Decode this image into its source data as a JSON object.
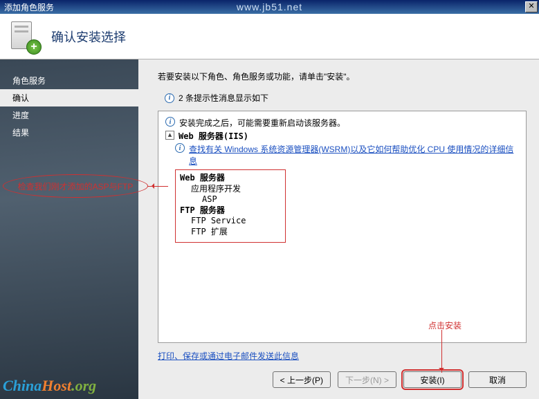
{
  "window": {
    "title": "添加角色服务",
    "watermark": "www.jb51.net",
    "close": "✕"
  },
  "header": {
    "title": "确认安装选择"
  },
  "sidebar": {
    "items": [
      {
        "label": "角色服务",
        "active": false
      },
      {
        "label": "确认",
        "active": true
      },
      {
        "label": "进度",
        "active": false
      },
      {
        "label": "结果",
        "active": false
      }
    ]
  },
  "main": {
    "instruction": "若要安装以下角色、角色服务或功能，请单击\"安装\"。",
    "sub": "2 条提示性消息显示如下",
    "notice": "安装完成之后，可能需要重新启动该服务器。",
    "section": "Web 服务器(IIS)",
    "wsrm_link": "查找有关 Windows 系统资源管理器(WSRM)以及它如何帮助优化 CPU 使用情况的详细信息",
    "highlight": {
      "web_server": "Web 服务器",
      "app_dev": "应用程序开发",
      "asp": "ASP",
      "ftp_server": "FTP 服务器",
      "ftp_service": "FTP Service",
      "ftp_ext": "FTP 扩展"
    },
    "email_link": "打印、保存或通过电子邮件发送此信息"
  },
  "callouts": {
    "oval": "检查我们刚才添加的ASP与FTP",
    "install": "点击安装"
  },
  "buttons": {
    "prev": "< 上一步(P)",
    "next": "下一步(N) >",
    "install": "安装(I)",
    "cancel": "取消"
  },
  "footer": {
    "logo_a": "China",
    "logo_b": "Host",
    "logo_c": ".org"
  }
}
